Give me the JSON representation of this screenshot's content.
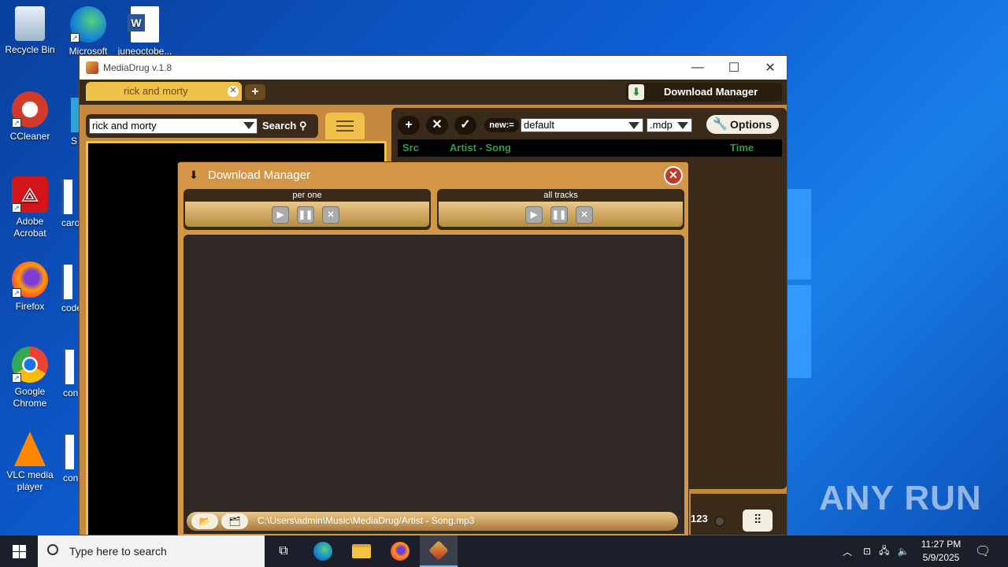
{
  "desktop": {
    "icons": [
      {
        "label": "Recycle Bin",
        "icon": "recycle-bin-icon"
      },
      {
        "label": "Microsoft",
        "icon": "edge-icon"
      },
      {
        "label": "juneoctobe...",
        "icon": "word-doc-icon"
      },
      {
        "label": "CCleaner",
        "icon": "ccleaner-icon"
      },
      {
        "label": "Adobe Acrobat",
        "icon": "acrobat-icon"
      },
      {
        "label": "Firefox",
        "icon": "firefox-icon"
      },
      {
        "label": "Google Chrome",
        "icon": "chrome-icon"
      },
      {
        "label": "VLC media player",
        "icon": "vlc-icon"
      }
    ],
    "partial_labels": [
      "S",
      "caro",
      "code",
      "con",
      "con"
    ],
    "watermark": "ANY RUN"
  },
  "app": {
    "title": "MediaDrug v.1.8",
    "tab_label": "rick and morty",
    "download_manager_label": "Download Manager",
    "search_value": "rick and morty",
    "search_button": "Search",
    "preset_select": "default",
    "format_select": ".mdp",
    "new_badge": "new:=",
    "options_label": "Options",
    "columns": {
      "src": "Src",
      "artist_song": "Artist - Song",
      "time": "Time"
    },
    "counter_label": "123"
  },
  "download_manager": {
    "title": "Download Manager",
    "per_one_label": "per one",
    "all_tracks_label": "all tracks",
    "output_path": "C:\\Users\\admin\\Music\\MediaDrug/Artist - Song.mp3"
  },
  "taskbar": {
    "search_placeholder": "Type here to search",
    "time": "11:27 PM",
    "date": "5/9/2025"
  },
  "colors": {
    "app_frame": "#c58a3e",
    "app_dark": "#3a2a1a",
    "tab_yellow": "#f0c24a",
    "column_green": "#2e9b45",
    "close_red": "#c0392b"
  }
}
